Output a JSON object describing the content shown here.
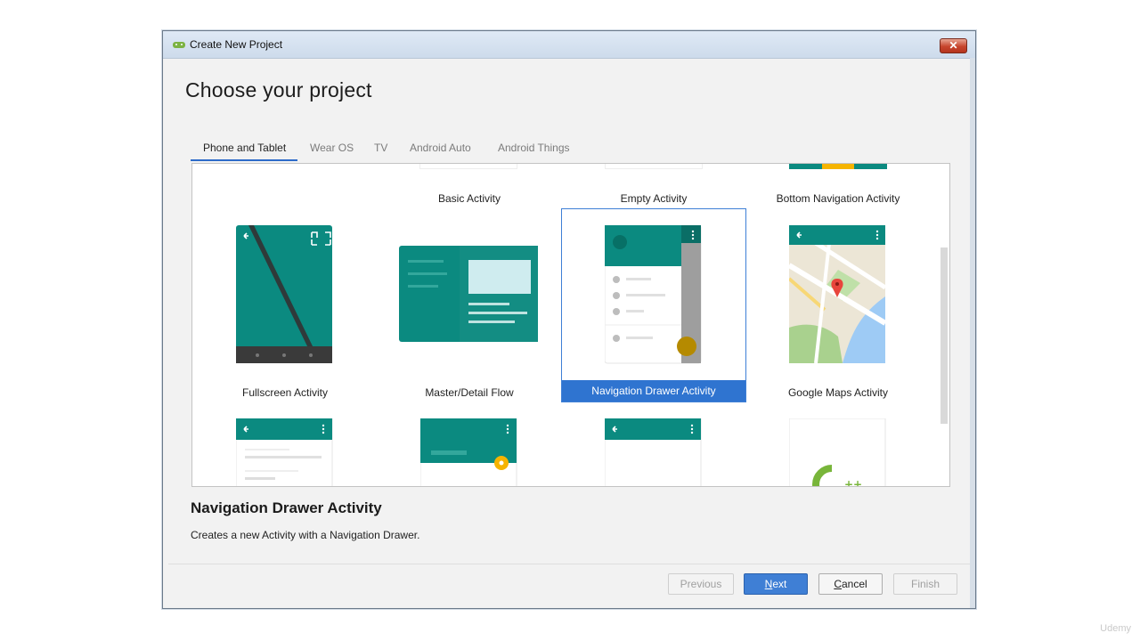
{
  "window": {
    "title": "Create New Project",
    "close_glyph": "✕"
  },
  "heading": "Choose your project",
  "tabs": [
    {
      "label": "Phone and Tablet",
      "active": true
    },
    {
      "label": "Wear OS"
    },
    {
      "label": "TV"
    },
    {
      "label": "Android Auto"
    },
    {
      "label": "Android Things"
    }
  ],
  "templates": {
    "row1": [
      "Basic Activity",
      "Empty Activity",
      "Bottom Navigation Activity"
    ],
    "row2": [
      "Fullscreen Activity",
      "Master/Detail Flow",
      "Navigation Drawer Activity",
      "Google Maps Activity"
    ]
  },
  "selected": {
    "title": "Navigation Drawer Activity",
    "description": "Creates a new Activity with a Navigation Drawer."
  },
  "buttons": {
    "previous": "Previous",
    "next_underlined": "N",
    "next_rest": "ext",
    "cancel_underlined": "C",
    "cancel_rest": "ancel",
    "finish": "Finish"
  },
  "colors": {
    "teal": "#0b8a80",
    "accent_blue": "#2f74d0",
    "fab": "#f5b400"
  },
  "watermark": "Udemy"
}
